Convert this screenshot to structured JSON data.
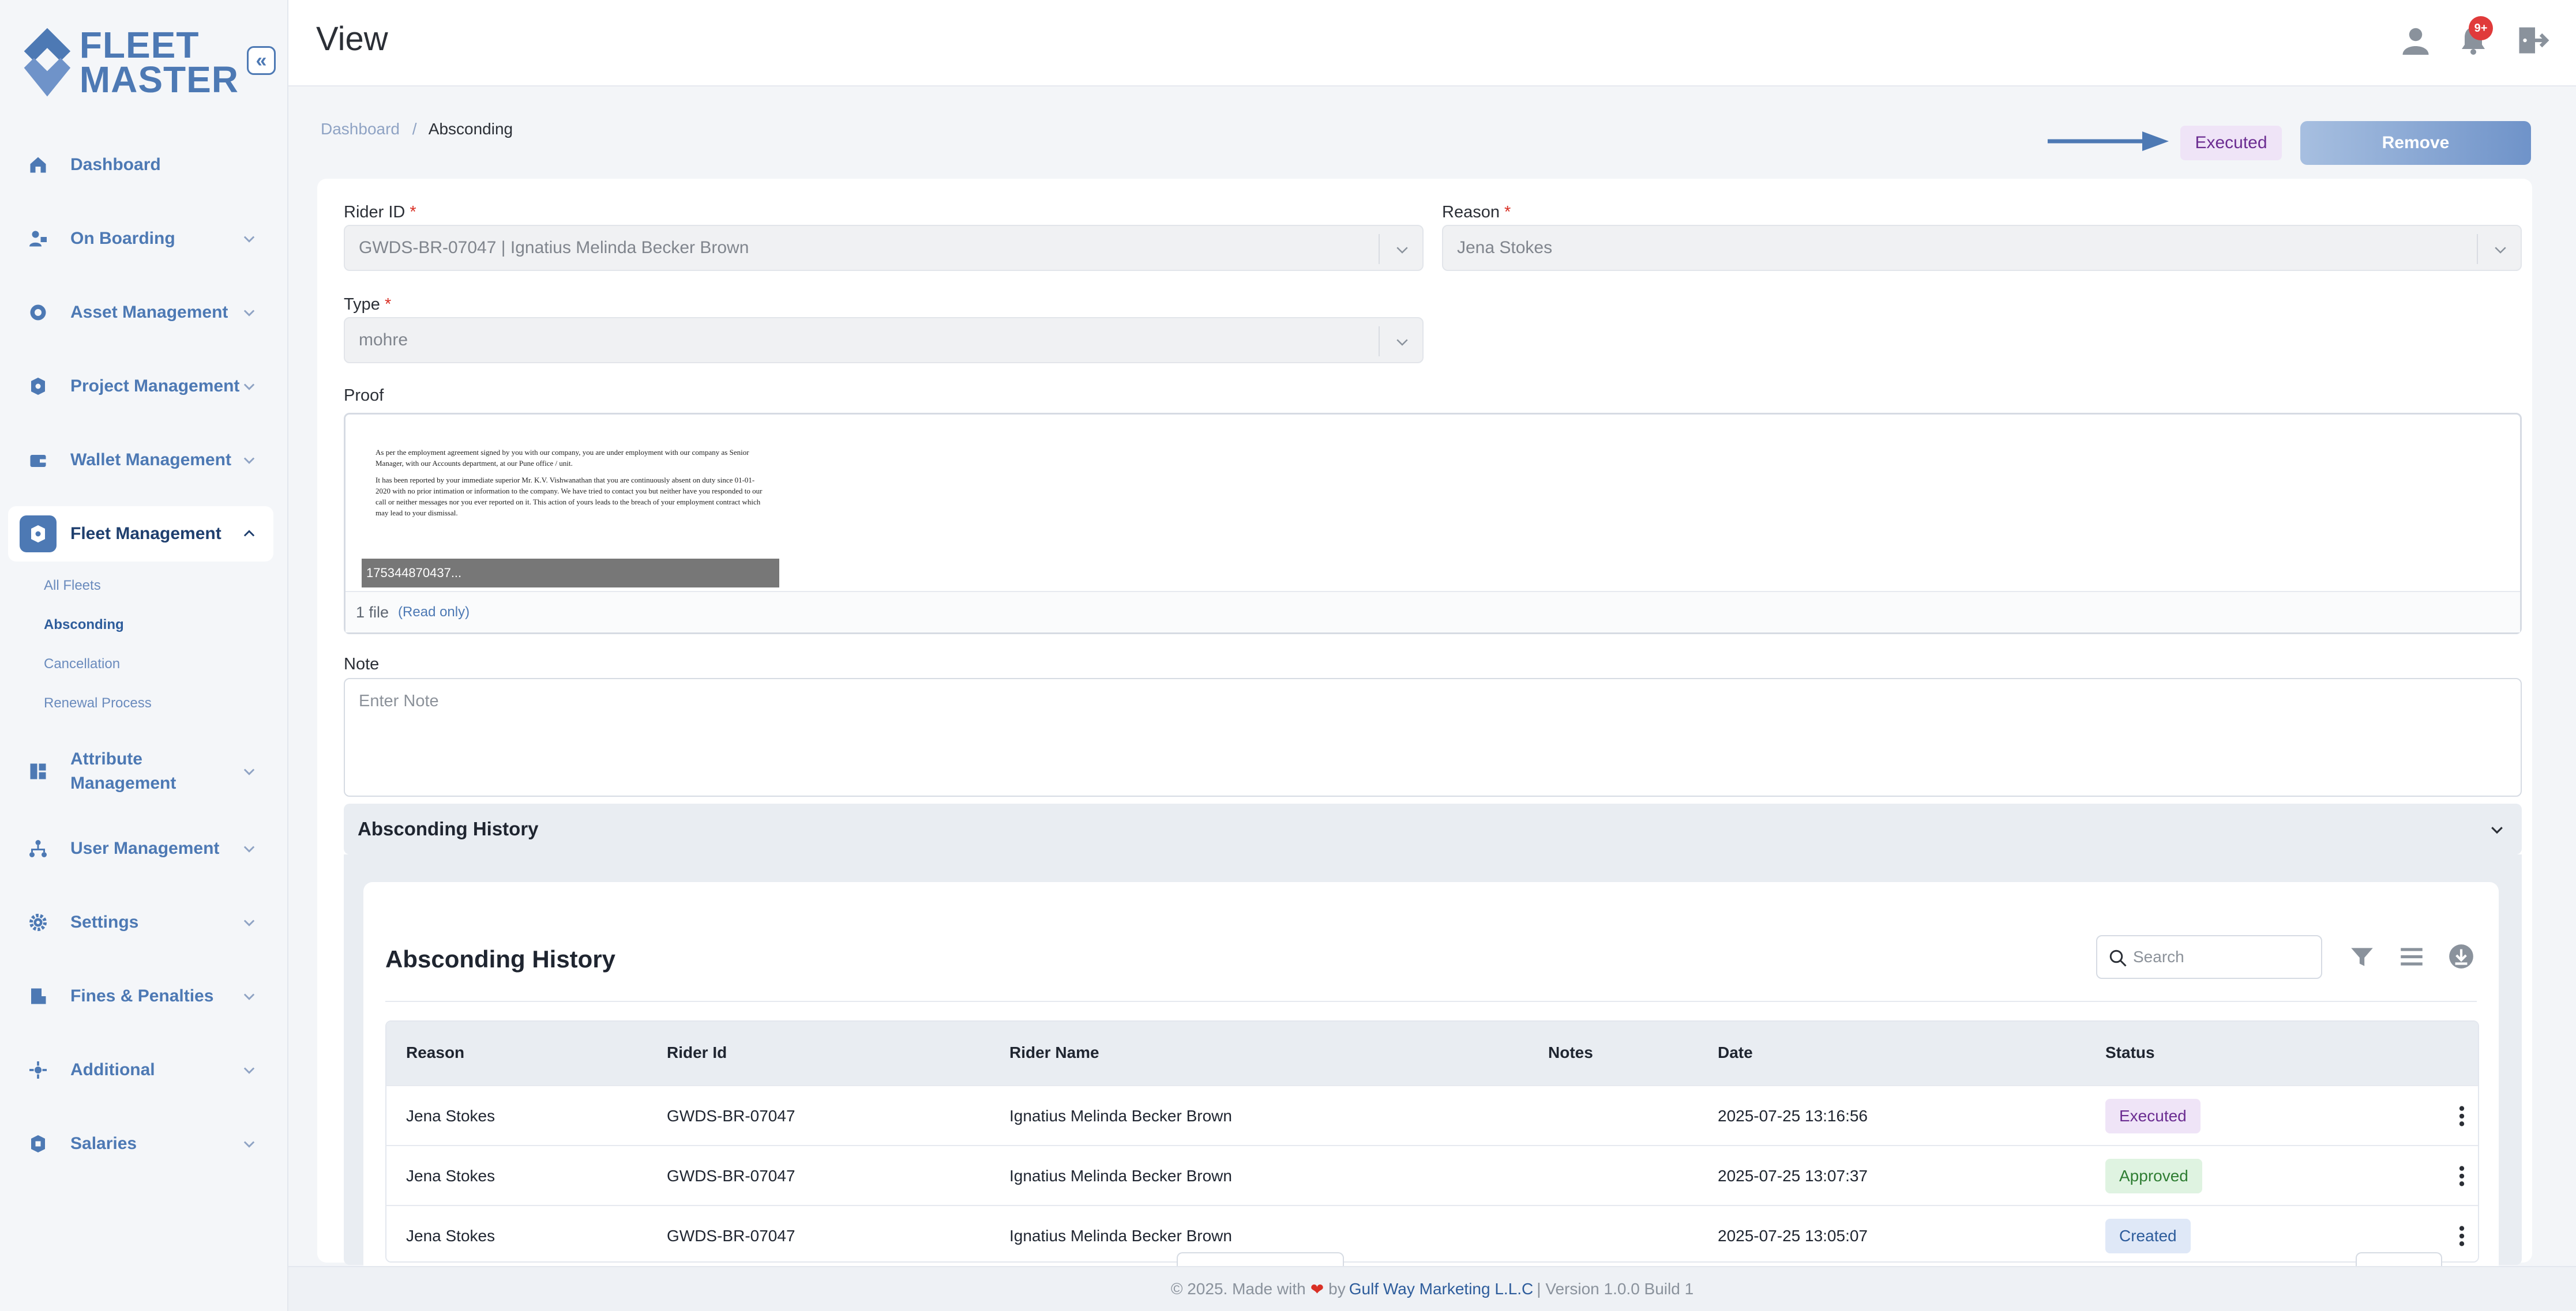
{
  "brand": {
    "line1": "FLEET",
    "line2": "MASTER",
    "color": "#4d79b4"
  },
  "sidebar": {
    "items": [
      {
        "label": "Dashboard",
        "icon": "home-icon"
      },
      {
        "label": "On Boarding",
        "icon": "user-board-icon"
      },
      {
        "label": "Asset Management",
        "icon": "asset-icon"
      },
      {
        "label": "Project Management",
        "icon": "project-icon"
      },
      {
        "label": "Wallet Management",
        "icon": "wallet-icon"
      },
      {
        "label": "Fleet Management",
        "icon": "fleet-icon"
      },
      {
        "label": "Attribute Management",
        "icon": "attribute-icon"
      },
      {
        "label": "User Management",
        "icon": "users-tree-icon"
      },
      {
        "label": "Settings",
        "icon": "gear-icon"
      },
      {
        "label": "Fines & Penalties",
        "icon": "fines-icon"
      },
      {
        "label": "Additional",
        "icon": "additional-icon"
      },
      {
        "label": "Salaries",
        "icon": "salary-icon"
      }
    ],
    "fleet_sub": [
      {
        "label": "All Fleets"
      },
      {
        "label": "Absconding"
      },
      {
        "label": "Cancellation"
      },
      {
        "label": "Renewal Process"
      }
    ]
  },
  "header": {
    "title": "View",
    "notification_count": "9+"
  },
  "breadcrumb": {
    "root": "Dashboard",
    "separator": "/",
    "current": "Absconding"
  },
  "actions": {
    "status": "Executed",
    "remove_label": "Remove"
  },
  "form": {
    "rider_id": {
      "label": "Rider ID",
      "required": "*",
      "value": "GWDS-BR-07047 | Ignatius Melinda Becker Brown"
    },
    "reason": {
      "label": "Reason",
      "required": "*",
      "value": "Jena Stokes"
    },
    "type": {
      "label": "Type",
      "required": "*",
      "value": "mohre"
    },
    "proof": {
      "label": "Proof",
      "file_name": "175344870437...",
      "count": "1 file",
      "mode": "(Read only)",
      "doc_p1": "As per the employment agreement signed by you with our company, you are under employment with our company as Senior Manager, with our Accounts department, at our Pune office / unit.",
      "doc_p2": "It has been reported by your immediate superior Mr. K.V. Vishwanathan that you are continuously absent on duty since 01-01-2020 with no prior intimation or information to the company. We have tried to contact you but neither have you responded to our call or neither messages nor you ever reported on it. This action of yours leads to the breach of your employment contract which may lead to your dismissal."
    },
    "note": {
      "label": "Note",
      "placeholder": "Enter Note"
    }
  },
  "history": {
    "accordion_title": "Absconding History",
    "title": "Absconding History",
    "search_placeholder": "Search",
    "columns": [
      "Reason",
      "Rider Id",
      "Rider Name",
      "Notes",
      "Date",
      "Status"
    ],
    "rows": [
      {
        "reason": "Jena Stokes",
        "rider_id": "GWDS-BR-07047",
        "rider_name": "Ignatius Melinda Becker Brown",
        "notes": "",
        "date": "2025-07-25 13:16:56",
        "status": "Executed"
      },
      {
        "reason": "Jena Stokes",
        "rider_id": "GWDS-BR-07047",
        "rider_name": "Ignatius Melinda Becker Brown",
        "notes": "",
        "date": "2025-07-25 13:07:37",
        "status": "Approved"
      },
      {
        "reason": "Jena Stokes",
        "rider_id": "GWDS-BR-07047",
        "rider_name": "Ignatius Melinda Becker Brown",
        "notes": "",
        "date": "2025-07-25 13:05:07",
        "status": "Created"
      }
    ]
  },
  "footer": {
    "prefix": "© 2025. Made with",
    "by": "by",
    "company": "Gulf Way Marketing L.L.C",
    "version": "| Version 1.0.0 Build 1"
  },
  "colors": {
    "accent": "#4d79b4",
    "executed": "#6b2c91",
    "approved": "#2e7d32",
    "created": "#2d5c9b",
    "badge": "#e03a3a"
  }
}
